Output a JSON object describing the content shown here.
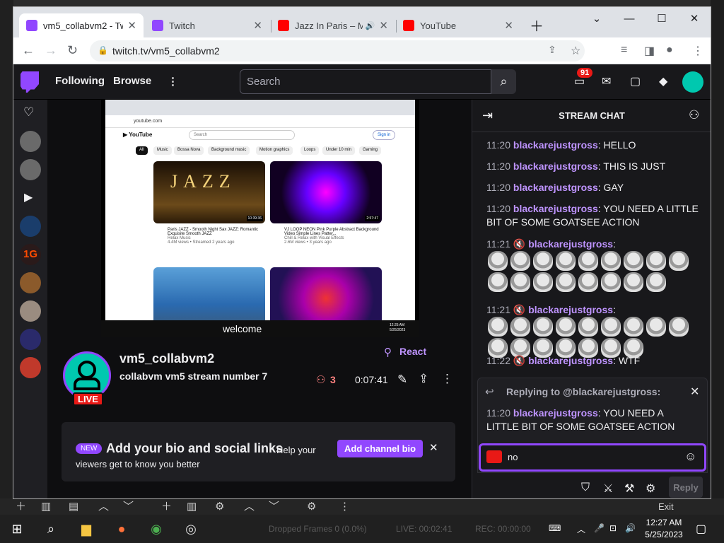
{
  "browser": {
    "tabs": [
      {
        "title": "vm5_collabvm2 - Twitch",
        "favicon_color": "#9147ff",
        "active": true
      },
      {
        "title": "Twitch",
        "favicon_color": "#9147ff",
        "active": false
      },
      {
        "title": "Jazz In Paris – Me",
        "favicon_color": "#ff0000",
        "active": false,
        "audio": true
      },
      {
        "title": "YouTube",
        "favicon_color": "#ff0000",
        "active": false
      }
    ],
    "url": "twitch.tv/vm5_collabvm2"
  },
  "twitch": {
    "nav": {
      "following": "Following",
      "browse": "Browse",
      "search_placeholder": "Search",
      "notif_count": "91"
    },
    "stream": {
      "overlay_text": "welcome",
      "channel": "vm5_collabvm2",
      "title": "collabvm vm5 stream number 7",
      "live_label": "LIVE",
      "react_label": "React",
      "viewers": "3",
      "uptime": "0:07:41"
    },
    "bio": {
      "new_label": "NEW",
      "title": "Add your bio and social links",
      "subtitle": "Help your viewers get to know you better",
      "button": "Add channel bio"
    },
    "chat": {
      "title": "STREAM CHAT",
      "messages": [
        {
          "time": "11:20",
          "user": "blackarejustgross",
          "text": "HELLO"
        },
        {
          "time": "11:20",
          "user": "blackarejustgross",
          "text": "THIS IS JUST"
        },
        {
          "time": "11:20",
          "user": "blackarejustgross",
          "text": "GAY"
        },
        {
          "time": "11:20",
          "user": "blackarejustgross",
          "text": "YOU NEED A LITTLE BIT OF SOME GOATSEE ACTION"
        },
        {
          "time": "11:21",
          "user": "blackarejustgross",
          "text": ""
        },
        {
          "time": "11:21",
          "user": "blackarejustgross",
          "text": ""
        },
        {
          "time": "11:22",
          "user": "blackarejustgross",
          "text": "WTF"
        }
      ],
      "replying_to": "Replying to @blackarejustgross:",
      "reply_quote": {
        "time": "11:20",
        "user": "blackarejustgross",
        "text": "YOU NEED A LITTLE BIT OF SOME GOATSEE ACTION"
      },
      "input_value": "no",
      "reply_button": "Reply"
    }
  },
  "video_content": {
    "url": "youtube.com",
    "search": "Search",
    "signin": "Sign in",
    "chips": [
      "All",
      "Music",
      "Bossa Nova",
      "Background music",
      "Motion graphics",
      "Loops",
      "Under 10 min",
      "Gaming"
    ],
    "videos": [
      {
        "title": "Paris JAZZ - Smooth Night Sax JAZZ: Romantic Exquisite Smooth JAZZ",
        "channel": "Relax Music",
        "meta": "4.4M views • Streamed 2 years ago",
        "duration": "10:39:36",
        "thumb_text": "JAZZ"
      },
      {
        "title": "VJ LOOP NEON Pink Purple Abstract Background Video Simple Lines Patter...",
        "channel": "Chill & Relax with Visual Effects",
        "meta": "2.6M views • 3 years ago",
        "duration": "2:57:47"
      }
    ],
    "clock": "12:25 AM 5/25/2023"
  },
  "obs": {
    "exit_label": "Exit",
    "dropped_frames": "Dropped Frames 0 (0.0%)",
    "live": "LIVE: 00:02:41",
    "rec": "REC: 00:00:00"
  },
  "taskbar": {
    "time": "12:27 AM",
    "date": "5/25/2023"
  },
  "colors": {
    "twitch_purple": "#9147ff",
    "username": "#bf94ff",
    "live_red": "#e91916",
    "avatar_teal": "#00c8af"
  }
}
